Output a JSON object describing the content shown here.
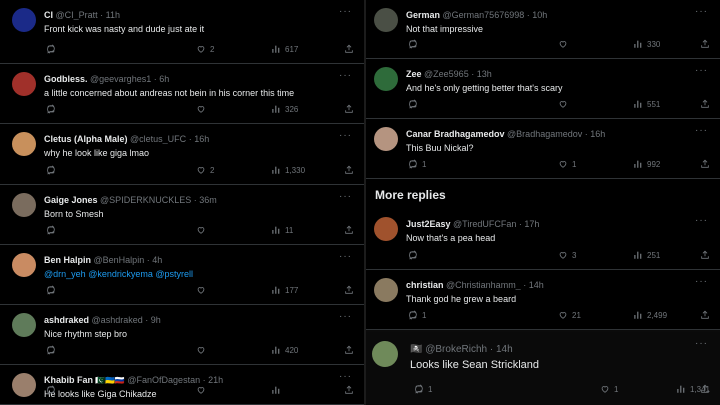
{
  "left": [
    {
      "name": "CI",
      "handle": "@CI_Pratt",
      "time": "11h",
      "text": "Front kick was nasty and dude just ate it",
      "reply": "",
      "retweet": "",
      "like": "2",
      "views": "617",
      "avatar_color": "#1b2a88"
    },
    {
      "name": "Godbless.",
      "handle": "@geevarghes1",
      "time": "6h",
      "text": "a little concerned about andreas not bein in his corner this time",
      "reply": "",
      "retweet": "",
      "like": "",
      "views": "326",
      "avatar_color": "#a0302a"
    },
    {
      "name": "Cletus (Alpha Male)",
      "handle": "@cletus_UFC",
      "time": "16h",
      "text": "why he look like giga lmao",
      "reply": "",
      "retweet": "",
      "like": "2",
      "views": "1,330",
      "avatar_color": "#c8905c"
    },
    {
      "name": "Gaige Jones",
      "handle": "@SPIDERKNUCKLES",
      "time": "36m",
      "text": "Born to Smesh",
      "reply": "",
      "retweet": "",
      "like": "",
      "views": "11",
      "avatar_color": "#7a6c5e"
    },
    {
      "name": "Ben Halpin",
      "handle": "@BenHalpin",
      "time": "4h",
      "text": "",
      "mentions": [
        "@drn_yeh",
        "@kendrickyema",
        "@pstyrell"
      ],
      "reply": "",
      "retweet": "",
      "like": "",
      "views": "177",
      "avatar_color": "#c98b62"
    },
    {
      "name": "ashdraked",
      "handle": "@ashdraked",
      "time": "9h",
      "text": "Nice rhythm step bro",
      "reply": "",
      "retweet": "",
      "like": "",
      "views": "420",
      "avatar_color": "#5f7b5a"
    },
    {
      "name": "Khabib Fan",
      "flags": "🇵🇰🇺🇦🇷🇺",
      "handle": "@FanOfDagestan",
      "time": "21h",
      "text": "He looks like Giga Chikadze",
      "reply": "",
      "retweet": "",
      "like": "",
      "views": "",
      "avatar_color": "#9a7f6c"
    }
  ],
  "right_top": [
    {
      "name": "German",
      "handle": "@German75676998",
      "time": "10h",
      "text": "Not that impressive",
      "reply": "",
      "retweet": "",
      "like": "",
      "views": "330",
      "avatar_color": "#4a4f45"
    },
    {
      "name": "Zee",
      "handle": "@Zee5965",
      "time": "13h",
      "text": "And he's only getting better that's scary",
      "reply": "",
      "retweet": "",
      "like": "",
      "views": "551",
      "avatar_color": "#2e6b3a"
    },
    {
      "name": "Canar Bradhagamedov",
      "handle": "@Bradhagamedov",
      "time": "16h",
      "text": "This Buu Nickal?",
      "reply": "1",
      "retweet": "",
      "like": "1",
      "views": "992",
      "avatar_color": "#b59480"
    }
  ],
  "section_title": "More replies",
  "right_more": [
    {
      "name": "Just2Easy",
      "handle": "@TiredUFCFan",
      "time": "17h",
      "text": "Now that's a pea head",
      "reply": "",
      "retweet": "",
      "like": "3",
      "views": "251",
      "avatar_color": "#a0522d"
    },
    {
      "name": "christian",
      "handle": "@Christianhamm_",
      "time": "14h",
      "text": "Thank god he grew a beard",
      "reply": "1",
      "retweet": "",
      "like": "21",
      "views": "2,499",
      "avatar_color": "#8a7a60"
    }
  ],
  "bottom": {
    "name": "🏴‍☠️",
    "handle": "@BrokeRichh",
    "time": "14h",
    "text": "Looks like Sean Strickland",
    "reply": "1",
    "retweet": "",
    "like": "1",
    "views": "1,341",
    "avatar_color": "#6f8a5a"
  },
  "icons": {
    "reply": "reply-icon",
    "retweet": "retweet-icon",
    "like": "like-icon",
    "views": "views-icon",
    "share": "share-icon",
    "more": "more-icon"
  }
}
